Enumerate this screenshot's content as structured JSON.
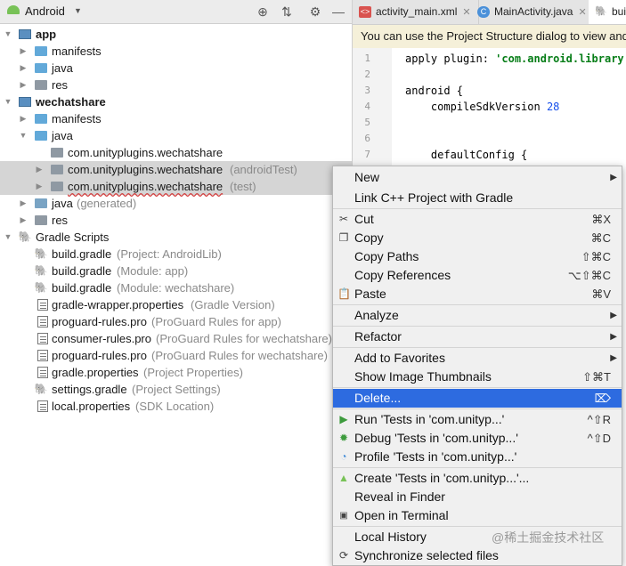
{
  "project_panel": {
    "view_selector": "Android",
    "tree": [
      {
        "label": "app",
        "bold": true
      },
      {
        "label": "manifests"
      },
      {
        "label": "java"
      },
      {
        "label": "res"
      },
      {
        "label": "wechatshare",
        "bold": true
      },
      {
        "label": "manifests"
      },
      {
        "label": "java"
      },
      {
        "label": "com.unityplugins.wechatshare"
      },
      {
        "label": "com.unityplugins.wechatshare",
        "suffix": "(androidTest)"
      },
      {
        "label": "com.unityplugins.wechatshare",
        "suffix": "(test)"
      },
      {
        "label": "java",
        "suffix": "(generated)"
      },
      {
        "label": "res"
      },
      {
        "label": "Gradle Scripts"
      },
      {
        "label": "build.gradle",
        "suffix": "(Project: AndroidLib)"
      },
      {
        "label": "build.gradle",
        "suffix": "(Module: app)"
      },
      {
        "label": "build.gradle",
        "suffix": "(Module: wechatshare)"
      },
      {
        "label": "gradle-wrapper.properties",
        "suffix": "(Gradle Version)"
      },
      {
        "label": "proguard-rules.pro",
        "suffix": "(ProGuard Rules for app)"
      },
      {
        "label": "consumer-rules.pro",
        "suffix": "(ProGuard Rules for wechatshare)"
      },
      {
        "label": "proguard-rules.pro",
        "suffix": "(ProGuard Rules for wechatshare)"
      },
      {
        "label": "gradle.properties",
        "suffix": "(Project Properties)"
      },
      {
        "label": "settings.gradle",
        "suffix": "(Project Settings)"
      },
      {
        "label": "local.properties",
        "suffix": "(SDK Location)"
      }
    ]
  },
  "editor": {
    "tabs": [
      {
        "label": "activity_main.xml"
      },
      {
        "label": "MainActivity.java"
      },
      {
        "label": "bui"
      }
    ],
    "banner": "You can use the Project Structure dialog to view and",
    "line_numbers": [
      "1",
      "2",
      "3",
      "4",
      "5",
      "6",
      "7"
    ],
    "code": {
      "l1a": "apply plugin: ",
      "l1b": "'com.android.library'",
      "l3": "android {",
      "l4a": "    compileSdkVersion ",
      "l4b": "28",
      "l7": "    defaultConfig {"
    }
  },
  "context_menu": {
    "items": [
      {
        "label": "New"
      },
      {
        "label": "Link C++ Project with Gradle"
      },
      {
        "label": "Cut",
        "shortcut": "⌘X",
        "icon": "scissors-icon"
      },
      {
        "label": "Copy",
        "shortcut": "⌘C",
        "icon": "copy-icon"
      },
      {
        "label": "Copy Paths",
        "shortcut": "⇧⌘C"
      },
      {
        "label": "Copy References",
        "shortcut": "⌥⇧⌘C"
      },
      {
        "label": "Paste",
        "shortcut": "⌘V",
        "icon": "paste-icon"
      },
      {
        "label": "Analyze"
      },
      {
        "label": "Refactor"
      },
      {
        "label": "Add to Favorites"
      },
      {
        "label": "Show Image Thumbnails",
        "shortcut": "⇧⌘T"
      },
      {
        "label": "Delete...",
        "shortcut": "⌦"
      },
      {
        "label": "Run 'Tests in 'com.unityp...'",
        "shortcut": "^⇧R",
        "icon": "run-icon"
      },
      {
        "label": "Debug 'Tests in 'com.unityp...'",
        "shortcut": "^⇧D",
        "icon": "debug-icon"
      },
      {
        "label": "Profile 'Tests in 'com.unityp...'",
        "icon": "profile-icon"
      },
      {
        "label": "Create 'Tests in 'com.unityp...'...",
        "icon": "android-icon"
      },
      {
        "label": "Reveal in Finder"
      },
      {
        "label": "Open in Terminal",
        "icon": "terminal-icon"
      },
      {
        "label": "Local History"
      },
      {
        "label": "Synchronize selected files",
        "icon": "sync-icon"
      }
    ]
  },
  "watermark": "@稀土掘金技术社区",
  "colors": {
    "menu_highlight": "#2d6be0",
    "selection": "#d5d5d5",
    "banner": "#f5f0d9"
  }
}
